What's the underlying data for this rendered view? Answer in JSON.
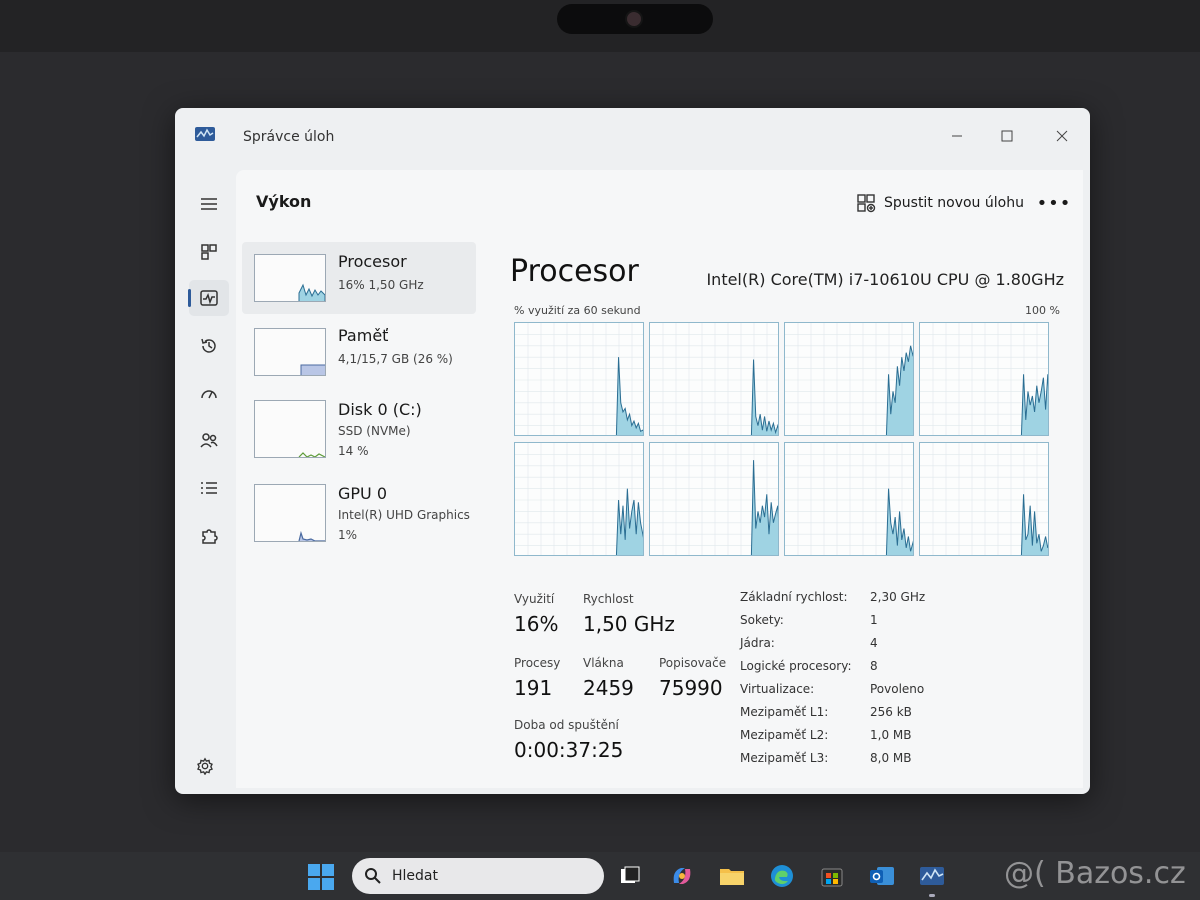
{
  "window": {
    "title": "Správce úloh"
  },
  "toolbar": {
    "page_title": "Výkon",
    "run_task_label": "Spustit novou úlohu",
    "more_label": "•••"
  },
  "devices": [
    {
      "name": "Procesor",
      "line1": "16%  1,50 GHz",
      "line2": ""
    },
    {
      "name": "Paměť",
      "line1": "4,1/15,7 GB (26 %)",
      "line2": ""
    },
    {
      "name": "Disk 0 (C:)",
      "line1": "SSD (NVMe)",
      "line2": "14 %"
    },
    {
      "name": "GPU 0",
      "line1": "Intel(R) UHD Graphics",
      "line2": "1%"
    }
  ],
  "detail": {
    "title": "Procesor",
    "model": "Intel(R) Core(TM) i7-10610U CPU @ 1.80GHz",
    "graph_caption": "% využití za 60 sekund",
    "graph_max": "100 %",
    "stats": {
      "utilization_label": "Využití",
      "utilization_value": "16%",
      "speed_label": "Rychlost",
      "speed_value": "1,50 GHz",
      "processes_label": "Procesy",
      "processes_value": "191",
      "threads_label": "Vlákna",
      "threads_value": "2459",
      "handles_label": "Popisovače",
      "handles_value": "75990",
      "uptime_label": "Doba od spuštění",
      "uptime_value": "0:00:37:25"
    },
    "specs": [
      {
        "key": "Základní rychlost:",
        "value": "2,30 GHz"
      },
      {
        "key": "Sokety:",
        "value": "1"
      },
      {
        "key": "Jádra:",
        "value": "4"
      },
      {
        "key": "Logické procesory:",
        "value": "8"
      },
      {
        "key": "Virtualizace:",
        "value": "Povoleno"
      },
      {
        "key": "Mezipaměť L1:",
        "value": "256 kB"
      },
      {
        "key": "Mezipaměť L2:",
        "value": "1,0 MB"
      },
      {
        "key": "Mezipaměť L3:",
        "value": "8,0 MB"
      }
    ]
  },
  "taskbar": {
    "search_label": "Hledat",
    "watermark": "@( Bazos.cz"
  },
  "colors": {
    "graph_fill": "#9fd3e3",
    "graph_line": "#2b6e93",
    "graph_border": "#8fb8cc",
    "memory_fill": "#b9c6e6",
    "disk_line": "#5e9c3a",
    "gpu_line": "#4a6aa0",
    "accent": "#2e5b9a"
  },
  "chart_data": [
    {
      "type": "area",
      "name": "core-0",
      "x": [
        0,
        1,
        2,
        3,
        4,
        5,
        6,
        7,
        8,
        9,
        10,
        11,
        12,
        13,
        14,
        15,
        16,
        17,
        18,
        19,
        20,
        21,
        22,
        23,
        24,
        25,
        26,
        27,
        28,
        29,
        30,
        31,
        32,
        33,
        34,
        35,
        36,
        37,
        38,
        39,
        40,
        41,
        42,
        43,
        44,
        45,
        46,
        47,
        48,
        49,
        50,
        51,
        52,
        53,
        54,
        55,
        56,
        57,
        58,
        59
      ],
      "values": [
        0,
        0,
        0,
        0,
        0,
        0,
        0,
        0,
        0,
        0,
        0,
        0,
        0,
        0,
        0,
        0,
        0,
        0,
        0,
        0,
        0,
        0,
        0,
        0,
        0,
        0,
        0,
        0,
        0,
        0,
        0,
        0,
        0,
        0,
        0,
        0,
        0,
        0,
        0,
        0,
        0,
        0,
        0,
        0,
        0,
        0,
        0,
        70,
        30,
        22,
        25,
        15,
        20,
        10,
        14,
        8,
        12,
        5,
        6,
        3
      ],
      "ylim": [
        0,
        100
      ]
    },
    {
      "type": "area",
      "name": "core-1",
      "x": [
        0,
        1,
        2,
        3,
        4,
        5,
        6,
        7,
        8,
        9,
        10,
        11,
        12,
        13,
        14,
        15,
        16,
        17,
        18,
        19,
        20,
        21,
        22,
        23,
        24,
        25,
        26,
        27,
        28,
        29,
        30,
        31,
        32,
        33,
        34,
        35,
        36,
        37,
        38,
        39,
        40,
        41,
        42,
        43,
        44,
        45,
        46,
        47,
        48,
        49,
        50,
        51,
        52,
        53,
        54,
        55,
        56,
        57,
        58,
        59
      ],
      "values": [
        0,
        0,
        0,
        0,
        0,
        0,
        0,
        0,
        0,
        0,
        0,
        0,
        0,
        0,
        0,
        0,
        0,
        0,
        0,
        0,
        0,
        0,
        0,
        0,
        0,
        0,
        0,
        0,
        0,
        0,
        0,
        0,
        0,
        0,
        0,
        0,
        0,
        0,
        0,
        0,
        0,
        0,
        0,
        0,
        0,
        0,
        0,
        68,
        18,
        10,
        20,
        6,
        18,
        5,
        14,
        6,
        12,
        4,
        10,
        3
      ],
      "ylim": [
        0,
        100
      ]
    },
    {
      "type": "area",
      "name": "core-2",
      "x": [
        0,
        1,
        2,
        3,
        4,
        5,
        6,
        7,
        8,
        9,
        10,
        11,
        12,
        13,
        14,
        15,
        16,
        17,
        18,
        19,
        20,
        21,
        22,
        23,
        24,
        25,
        26,
        27,
        28,
        29,
        30,
        31,
        32,
        33,
        34,
        35,
        36,
        37,
        38,
        39,
        40,
        41,
        42,
        43,
        44,
        45,
        46,
        47,
        48,
        49,
        50,
        51,
        52,
        53,
        54,
        55,
        56,
        57,
        58,
        59
      ],
      "values": [
        0,
        0,
        0,
        0,
        0,
        0,
        0,
        0,
        0,
        0,
        0,
        0,
        0,
        0,
        0,
        0,
        0,
        0,
        0,
        0,
        0,
        0,
        0,
        0,
        0,
        0,
        0,
        0,
        0,
        0,
        0,
        0,
        0,
        0,
        0,
        0,
        0,
        0,
        0,
        0,
        0,
        0,
        0,
        0,
        0,
        0,
        0,
        55,
        20,
        40,
        30,
        62,
        45,
        70,
        58,
        74,
        66,
        80,
        72,
        78
      ],
      "ylim": [
        0,
        100
      ]
    },
    {
      "type": "area",
      "name": "core-3",
      "x": [
        0,
        1,
        2,
        3,
        4,
        5,
        6,
        7,
        8,
        9,
        10,
        11,
        12,
        13,
        14,
        15,
        16,
        17,
        18,
        19,
        20,
        21,
        22,
        23,
        24,
        25,
        26,
        27,
        28,
        29,
        30,
        31,
        32,
        33,
        34,
        35,
        36,
        37,
        38,
        39,
        40,
        41,
        42,
        43,
        44,
        45,
        46,
        47,
        48,
        49,
        50,
        51,
        52,
        53,
        54,
        55,
        56,
        57,
        58,
        59
      ],
      "values": [
        0,
        0,
        0,
        0,
        0,
        0,
        0,
        0,
        0,
        0,
        0,
        0,
        0,
        0,
        0,
        0,
        0,
        0,
        0,
        0,
        0,
        0,
        0,
        0,
        0,
        0,
        0,
        0,
        0,
        0,
        0,
        0,
        0,
        0,
        0,
        0,
        0,
        0,
        0,
        0,
        0,
        0,
        0,
        0,
        0,
        0,
        0,
        55,
        15,
        40,
        28,
        36,
        22,
        45,
        30,
        40,
        52,
        24,
        55,
        20
      ],
      "ylim": [
        0,
        100
      ]
    },
    {
      "type": "area",
      "name": "core-4",
      "x": [
        0,
        1,
        2,
        3,
        4,
        5,
        6,
        7,
        8,
        9,
        10,
        11,
        12,
        13,
        14,
        15,
        16,
        17,
        18,
        19,
        20,
        21,
        22,
        23,
        24,
        25,
        26,
        27,
        28,
        29,
        30,
        31,
        32,
        33,
        34,
        35,
        36,
        37,
        38,
        39,
        40,
        41,
        42,
        43,
        44,
        45,
        46,
        47,
        48,
        49,
        50,
        51,
        52,
        53,
        54,
        55,
        56,
        57,
        58,
        59
      ],
      "values": [
        0,
        0,
        0,
        0,
        0,
        0,
        0,
        0,
        0,
        0,
        0,
        0,
        0,
        0,
        0,
        0,
        0,
        0,
        0,
        0,
        0,
        0,
        0,
        0,
        0,
        0,
        0,
        0,
        0,
        0,
        0,
        0,
        0,
        0,
        0,
        0,
        0,
        0,
        0,
        0,
        0,
        0,
        0,
        0,
        0,
        0,
        0,
        50,
        20,
        45,
        15,
        60,
        25,
        40,
        50,
        20,
        48,
        30,
        20,
        10
      ],
      "ylim": [
        0,
        100
      ]
    },
    {
      "type": "area",
      "name": "core-5",
      "x": [
        0,
        1,
        2,
        3,
        4,
        5,
        6,
        7,
        8,
        9,
        10,
        11,
        12,
        13,
        14,
        15,
        16,
        17,
        18,
        19,
        20,
        21,
        22,
        23,
        24,
        25,
        26,
        27,
        28,
        29,
        30,
        31,
        32,
        33,
        34,
        35,
        36,
        37,
        38,
        39,
        40,
        41,
        42,
        43,
        44,
        45,
        46,
        47,
        48,
        49,
        50,
        51,
        52,
        53,
        54,
        55,
        56,
        57,
        58,
        59
      ],
      "values": [
        0,
        0,
        0,
        0,
        0,
        0,
        0,
        0,
        0,
        0,
        0,
        0,
        0,
        0,
        0,
        0,
        0,
        0,
        0,
        0,
        0,
        0,
        0,
        0,
        0,
        0,
        0,
        0,
        0,
        0,
        0,
        0,
        0,
        0,
        0,
        0,
        0,
        0,
        0,
        0,
        0,
        0,
        0,
        0,
        0,
        0,
        0,
        85,
        25,
        40,
        30,
        45,
        35,
        55,
        20,
        48,
        30,
        38,
        45,
        10
      ],
      "ylim": [
        0,
        100
      ]
    },
    {
      "type": "area",
      "name": "core-6",
      "x": [
        0,
        1,
        2,
        3,
        4,
        5,
        6,
        7,
        8,
        9,
        10,
        11,
        12,
        13,
        14,
        15,
        16,
        17,
        18,
        19,
        20,
        21,
        22,
        23,
        24,
        25,
        26,
        27,
        28,
        29,
        30,
        31,
        32,
        33,
        34,
        35,
        36,
        37,
        38,
        39,
        40,
        41,
        42,
        43,
        44,
        45,
        46,
        47,
        48,
        49,
        50,
        51,
        52,
        53,
        54,
        55,
        56,
        57,
        58,
        59
      ],
      "values": [
        0,
        0,
        0,
        0,
        0,
        0,
        0,
        0,
        0,
        0,
        0,
        0,
        0,
        0,
        0,
        0,
        0,
        0,
        0,
        0,
        0,
        0,
        0,
        0,
        0,
        0,
        0,
        0,
        0,
        0,
        0,
        0,
        0,
        0,
        0,
        0,
        0,
        0,
        0,
        0,
        0,
        0,
        0,
        0,
        0,
        0,
        0,
        60,
        30,
        20,
        35,
        10,
        40,
        15,
        25,
        8,
        18,
        5,
        12,
        20
      ],
      "ylim": [
        0,
        100
      ]
    },
    {
      "type": "area",
      "name": "core-7",
      "x": [
        0,
        1,
        2,
        3,
        4,
        5,
        6,
        7,
        8,
        9,
        10,
        11,
        12,
        13,
        14,
        15,
        16,
        17,
        18,
        19,
        20,
        21,
        22,
        23,
        24,
        25,
        26,
        27,
        28,
        29,
        30,
        31,
        32,
        33,
        34,
        35,
        36,
        37,
        38,
        39,
        40,
        41,
        42,
        43,
        44,
        45,
        46,
        47,
        48,
        49,
        50,
        51,
        52,
        53,
        54,
        55,
        56,
        57,
        58,
        59
      ],
      "values": [
        0,
        0,
        0,
        0,
        0,
        0,
        0,
        0,
        0,
        0,
        0,
        0,
        0,
        0,
        0,
        0,
        0,
        0,
        0,
        0,
        0,
        0,
        0,
        0,
        0,
        0,
        0,
        0,
        0,
        0,
        0,
        0,
        0,
        0,
        0,
        0,
        0,
        0,
        0,
        0,
        0,
        0,
        0,
        0,
        0,
        0,
        0,
        55,
        15,
        20,
        45,
        10,
        40,
        12,
        20,
        5,
        10,
        18,
        8,
        15
      ],
      "ylim": [
        0,
        100
      ]
    }
  ]
}
